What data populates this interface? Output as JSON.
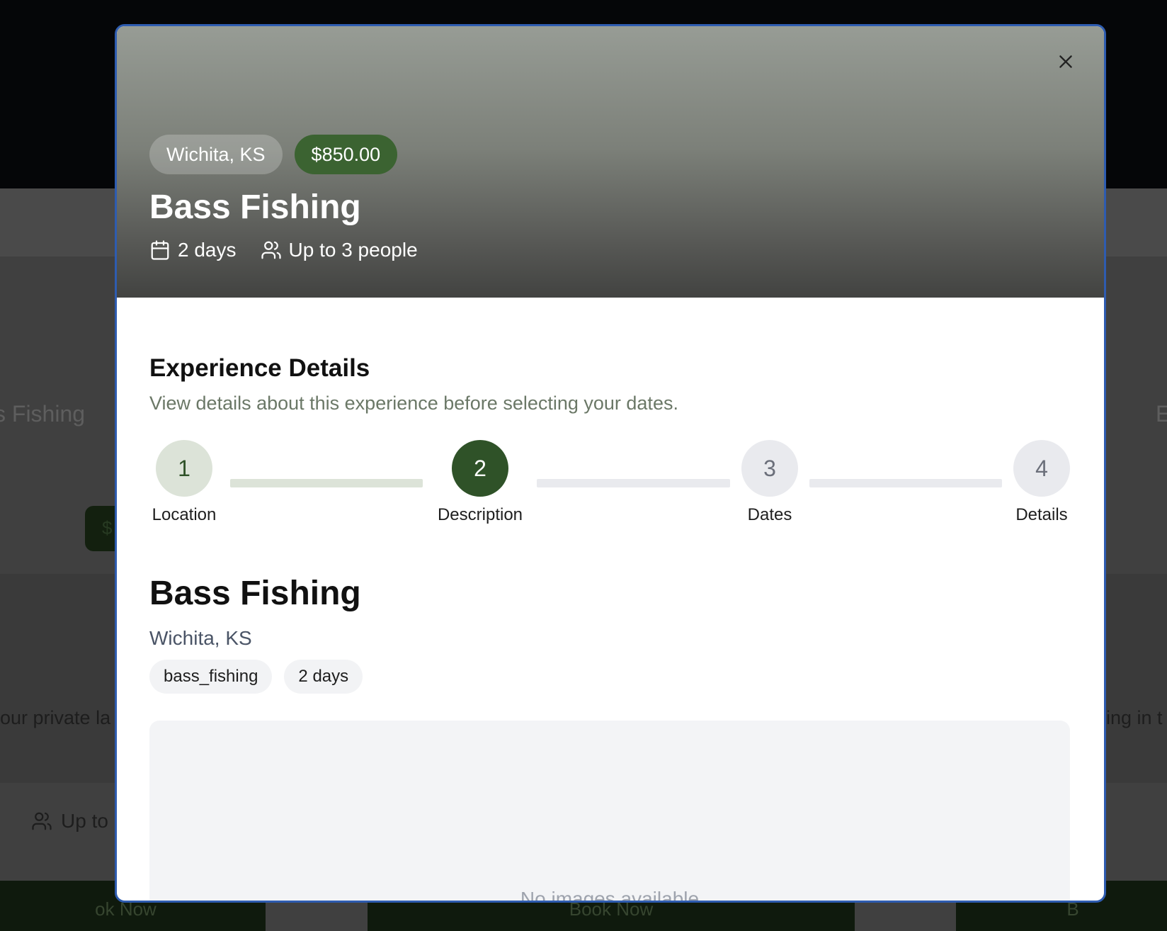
{
  "background": {
    "card_title_left": "s Fishing",
    "card_title_right": "E",
    "card_desc_left": "our private la",
    "card_desc_right": "ing in t",
    "card_people_left": "Up to",
    "price_pill_left": "$",
    "book_buttons": [
      "ok Now",
      "Book Now",
      "B"
    ]
  },
  "modal": {
    "close_label": "×",
    "hero": {
      "location": "Wichita, KS",
      "price": "$850.00",
      "title": "Bass Fishing",
      "duration": "2 days",
      "capacity": "Up to 3 people"
    },
    "section": {
      "title": "Experience Details",
      "subtitle": "View details about this experience before selecting your dates."
    },
    "steps": [
      {
        "number": "1",
        "label": "Location",
        "state": "completed"
      },
      {
        "number": "2",
        "label": "Description",
        "state": "active"
      },
      {
        "number": "3",
        "label": "Dates",
        "state": "upcoming"
      },
      {
        "number": "4",
        "label": "Details",
        "state": "upcoming"
      }
    ],
    "description": {
      "title": "Bass Fishing",
      "location": "Wichita, KS",
      "tags": [
        "bass_fishing",
        "2 days"
      ]
    },
    "gallery": {
      "empty_text": "No images available"
    }
  },
  "colors": {
    "accent_green": "#3b6331",
    "active_step": "#2f5228",
    "completed_step_bg": "#dce3d8",
    "upcoming_step_bg": "#e9eaee",
    "modal_border": "#2e5cb0"
  }
}
